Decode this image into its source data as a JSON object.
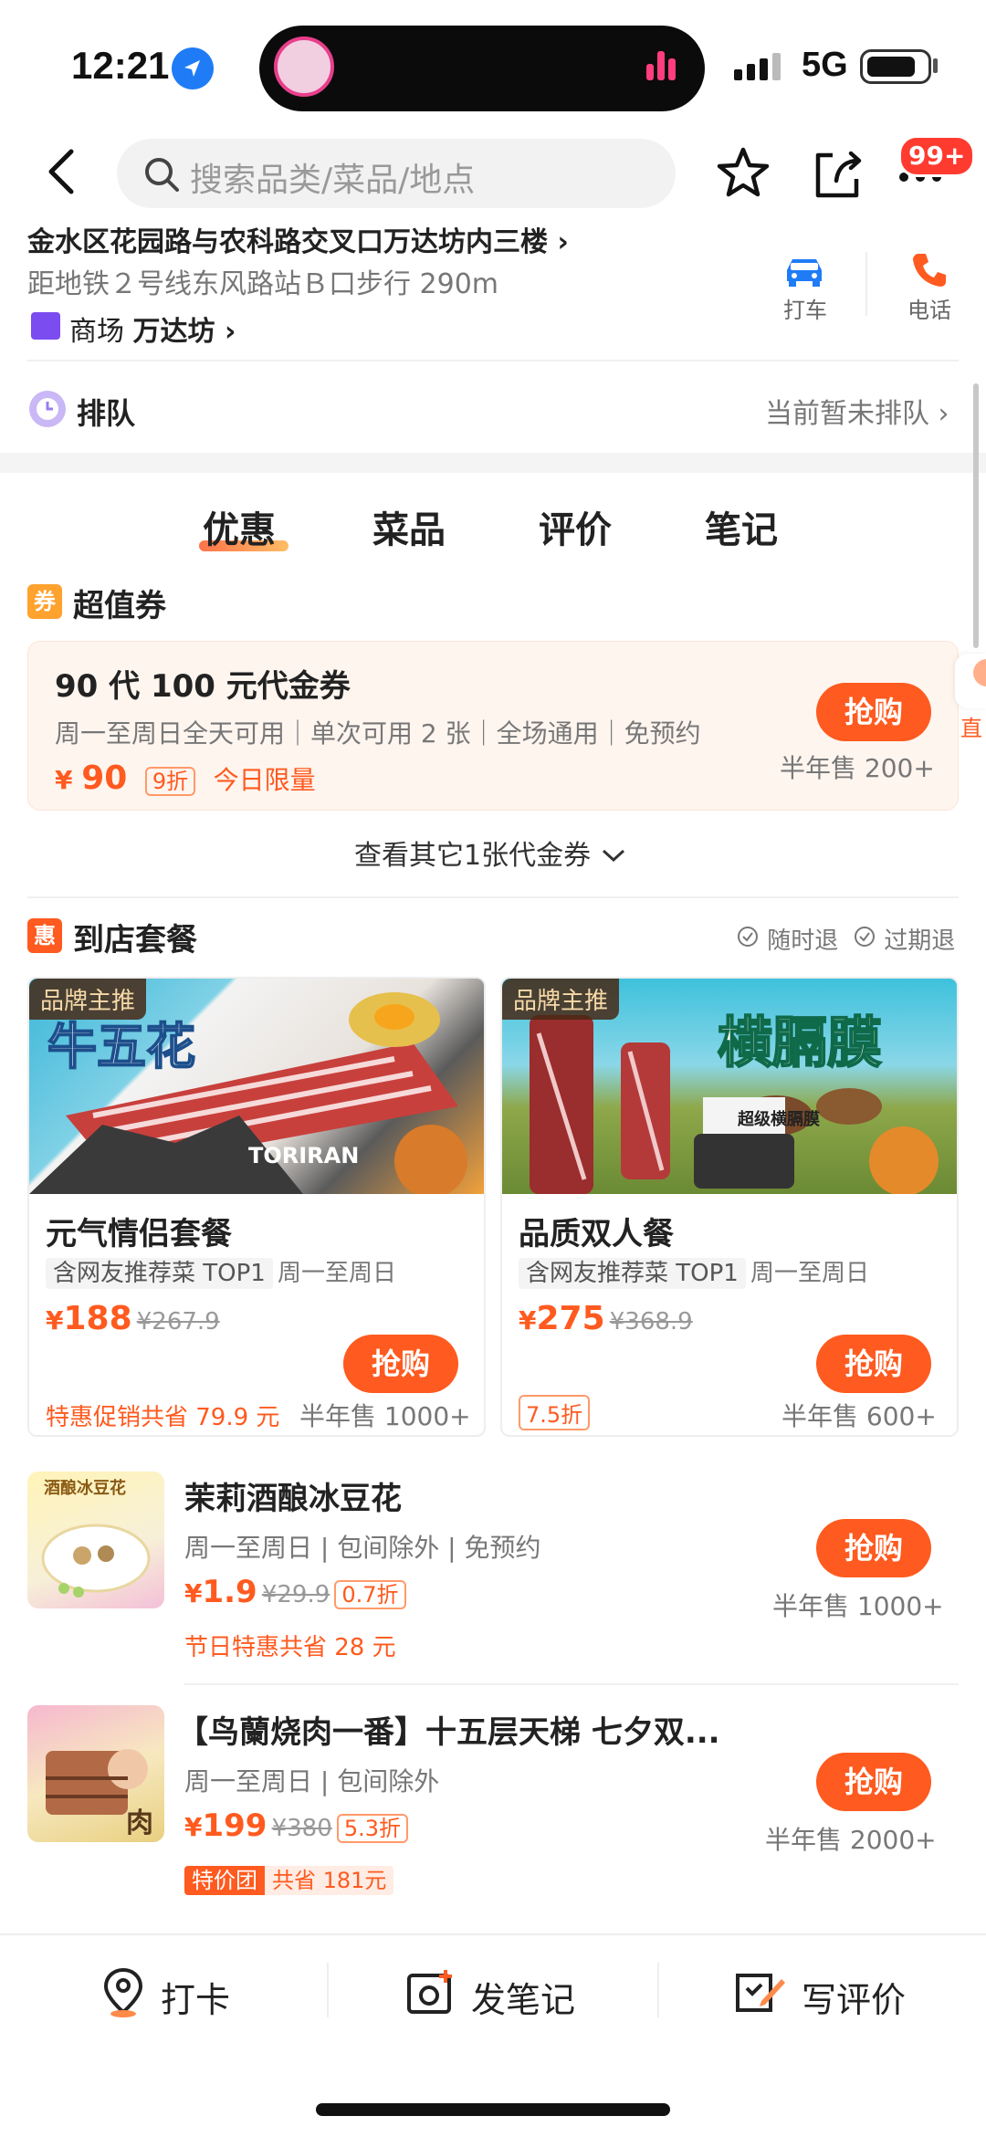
{
  "status_bar": {
    "time": "12:21",
    "network": "5G"
  },
  "header": {
    "search_placeholder": "搜索品类/菜品/地点",
    "badge": "99+"
  },
  "shop": {
    "address": "金水区花园路与农科路交叉口万达坊内三楼 ›",
    "distance": "距地铁２号线东风路站Ｂ口步行 290m",
    "mall_prefix": "商场",
    "mall_name": "万达坊 ›",
    "taxi_label": "打车",
    "phone_label": "电话"
  },
  "queue": {
    "label": "排队",
    "status": "当前暂未排队 ›"
  },
  "tabs": [
    "优惠",
    "菜品",
    "评价",
    "笔记"
  ],
  "coupons": {
    "section_icon": "券",
    "section_title": "超值券",
    "item": {
      "title": "90 代 100 元代金券",
      "desc": "周一至周日全天可用｜单次可用 2 张｜全场通用｜免预约",
      "price": "90",
      "currency": "¥",
      "discount": "9折",
      "limit": "今日限量",
      "buy": "抢购",
      "sold": "半年售 200+"
    },
    "peek_text": "直",
    "more": "查看其它1张代金券"
  },
  "packages": {
    "section_icon": "惠",
    "section_title": "到店套餐",
    "refund_anytime": "随时退",
    "refund_expired": "过期退",
    "items": [
      {
        "brand_tag": "品牌主推",
        "name": "元气情侣套餐",
        "pill": "含网友推荐菜 TOP1",
        "days": "周一至周日",
        "currency": "¥",
        "price": "188",
        "orig": "¥267.9",
        "buy": "抢购",
        "promo": "特惠促销共省 79.9 元",
        "sold": "半年售 1000+",
        "img_text": "牛五花",
        "img_sub": "TORIRAN"
      },
      {
        "brand_tag": "品牌主推",
        "name": "品质双人餐",
        "pill": "含网友推荐菜 TOP1",
        "days": "周一至周日",
        "currency": "¥",
        "price": "275",
        "orig": "¥368.9",
        "buy": "抢购",
        "promo": "7.5折",
        "sold": "半年售 600+",
        "img_text": "横膈膜",
        "img_sub": "超级横膈膜"
      }
    ]
  },
  "deals": [
    {
      "title": "茉莉酒酿冰豆花",
      "desc": "周一至周日 | 包间除外 | 免预约",
      "currency": "¥",
      "price": "1.9",
      "orig": "¥29.9",
      "discount": "0.7折",
      "promo": "节日特惠共省 28 元",
      "buy": "抢购",
      "sold": "半年售 1000+",
      "thumb_text": "酒酿冰豆花"
    },
    {
      "title": "【鸟蘭烧肉一番】十五层天梯 七夕双...",
      "desc": "周一至周日 | 包间除外",
      "currency": "¥",
      "price": "199",
      "orig": "¥380",
      "discount": "5.3折",
      "tag": "特价团",
      "tag_save": "共省 181元",
      "buy": "抢购",
      "sold": "半年售 2000+",
      "thumb_text": "肉"
    }
  ],
  "bottom_bar": {
    "checkin": "打卡",
    "note": "发笔记",
    "review": "写评价"
  },
  "colors": {
    "accent": "#ff5a1f",
    "badge": "#ff3b30",
    "link_blue": "#1f7cf6"
  }
}
